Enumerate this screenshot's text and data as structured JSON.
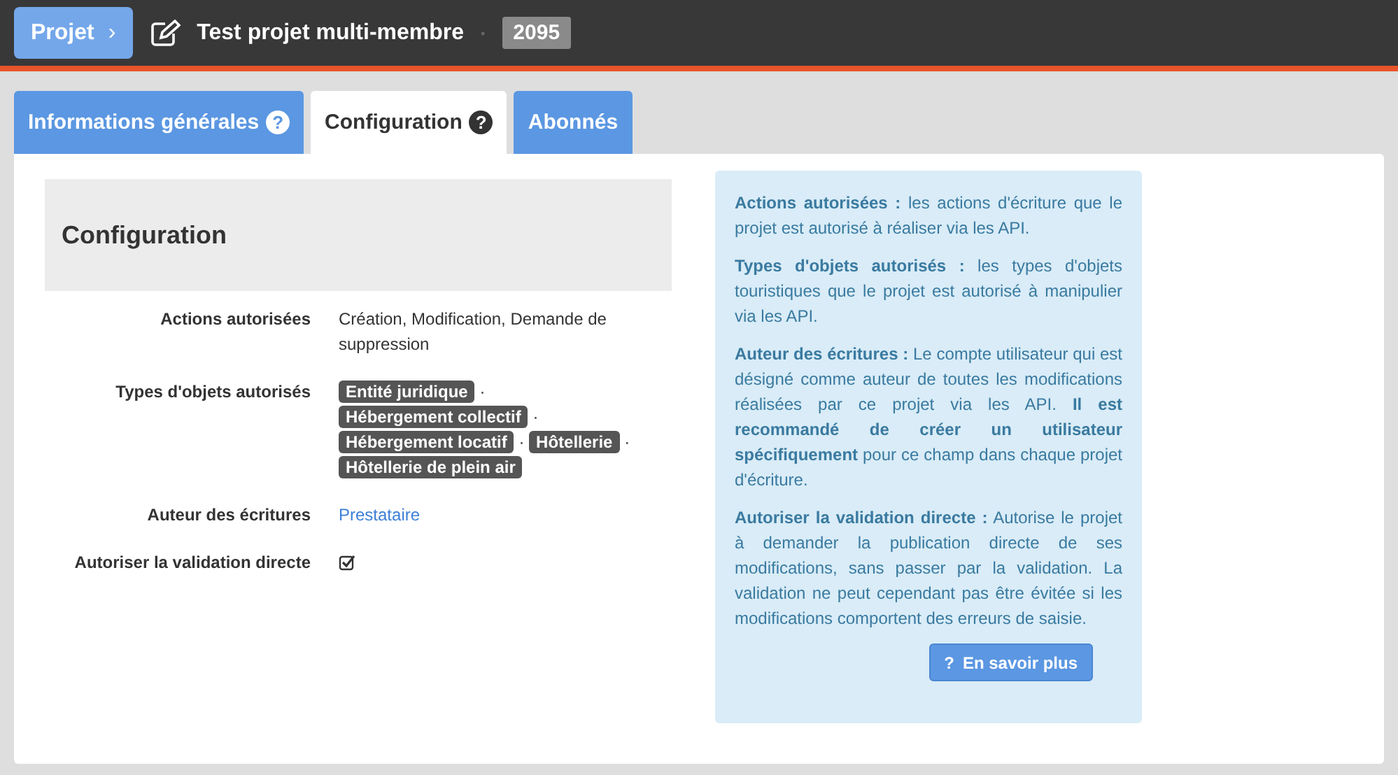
{
  "header": {
    "breadcrumb": "Projet",
    "breadcrumb_caret": "›",
    "title": "Test projet multi-membre",
    "separator": "•",
    "id": "2095"
  },
  "tabs": [
    {
      "label": "Informations générales",
      "help_icon": "?",
      "selected": false
    },
    {
      "label": "Configuration",
      "help_icon": "?",
      "selected": true
    },
    {
      "label": "Abonnés",
      "selected": false
    }
  ],
  "card": {
    "title": "Configuration",
    "rows": [
      {
        "kind": "text",
        "label": "Actions autorisées",
        "value": "Création, Modification, Demande de suppression"
      },
      {
        "kind": "tags",
        "label": "Types d'objets autorisés",
        "separator": "·",
        "tags": [
          "Entité juridique",
          "Hébergement collectif",
          "Hébergement locatif",
          "Hôtellerie",
          "Hôtellerie de plein air"
        ]
      },
      {
        "kind": "link",
        "label": "Auteur des écritures",
        "value": "Prestataire"
      },
      {
        "kind": "checkbox",
        "label": "Autoriser la validation directe",
        "checked": true
      }
    ]
  },
  "help": {
    "paragraphs": [
      "**Actions autorisées :** les actions d'écriture que le projet est autorisé à réaliser via les API.",
      "**Types d'objets autorisés :** les types d'objets touristiques que le projet est autorisé à manipulier via les API.",
      "**Auteur des écritures :** Le compte utilisateur qui est désigné comme auteur de toutes les modifications réalisées par ce projet via les API. **Il est recommandé de créer un utilisateur spécifiquement** pour ce champ dans chaque projet d'écriture.",
      "**Autoriser la validation directe :** Autorise le projet à demander la publication directe de ses modifications, sans passer par la validation. La validation ne peut cependant pas être évitée si les modifications comportent des erreurs de saisie."
    ],
    "button": {
      "icon": "?",
      "label": "En savoir plus"
    }
  }
}
